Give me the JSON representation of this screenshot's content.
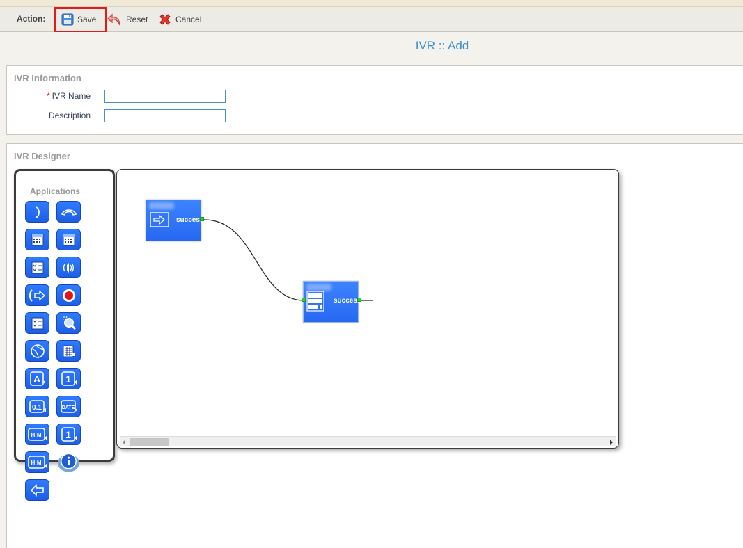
{
  "toolbar": {
    "action_label": "Action:",
    "save_label": "Save",
    "reset_label": "Reset",
    "cancel_label": "Cancel"
  },
  "page": {
    "title": "IVR :: Add"
  },
  "ivr_info": {
    "legend": "IVR Information",
    "name_required_mark": "*",
    "name_label": "IVR Name",
    "name_value": "",
    "description_label": "Description",
    "description_value": ""
  },
  "designer": {
    "legend": "IVR Designer",
    "palette_title": "Applications",
    "applications": [
      {
        "icon": "answer-icon"
      },
      {
        "icon": "hangup-icon"
      },
      {
        "icon": "calendar-icon"
      },
      {
        "icon": "calendar-time-icon"
      },
      {
        "icon": "checklist-icon"
      },
      {
        "icon": "speaker-icon"
      },
      {
        "icon": "transfer-icon"
      },
      {
        "icon": "record-icon"
      },
      {
        "icon": "menu-list-icon"
      },
      {
        "icon": "search-icon"
      },
      {
        "icon": "globe-icon"
      },
      {
        "icon": "keypad-list-icon"
      },
      {
        "icon": "say-alpha-icon",
        "text": "A"
      },
      {
        "icon": "say-number-icon",
        "text": "1"
      },
      {
        "icon": "say-digits-icon",
        "text": "0.1"
      },
      {
        "icon": "say-date-icon",
        "text": "DATE"
      },
      {
        "icon": "say-time-icon",
        "text": "H:M"
      },
      {
        "icon": "say-number2-icon",
        "text": "1"
      },
      {
        "icon": "say-time2-icon",
        "text": "H:M"
      },
      {
        "icon": "info-icon"
      },
      {
        "icon": "back-arrow-icon"
      }
    ],
    "nodes": [
      {
        "icon": "start-arrow-icon",
        "port_label": "success"
      },
      {
        "icon": "dtmf-keypad-icon",
        "port_label": "success"
      }
    ]
  },
  "colors": {
    "accent": "#3b8fd0",
    "highlight": "#e11b1b",
    "app_icon_blue": "#2f7bff",
    "port_green": "#2fd12f"
  }
}
